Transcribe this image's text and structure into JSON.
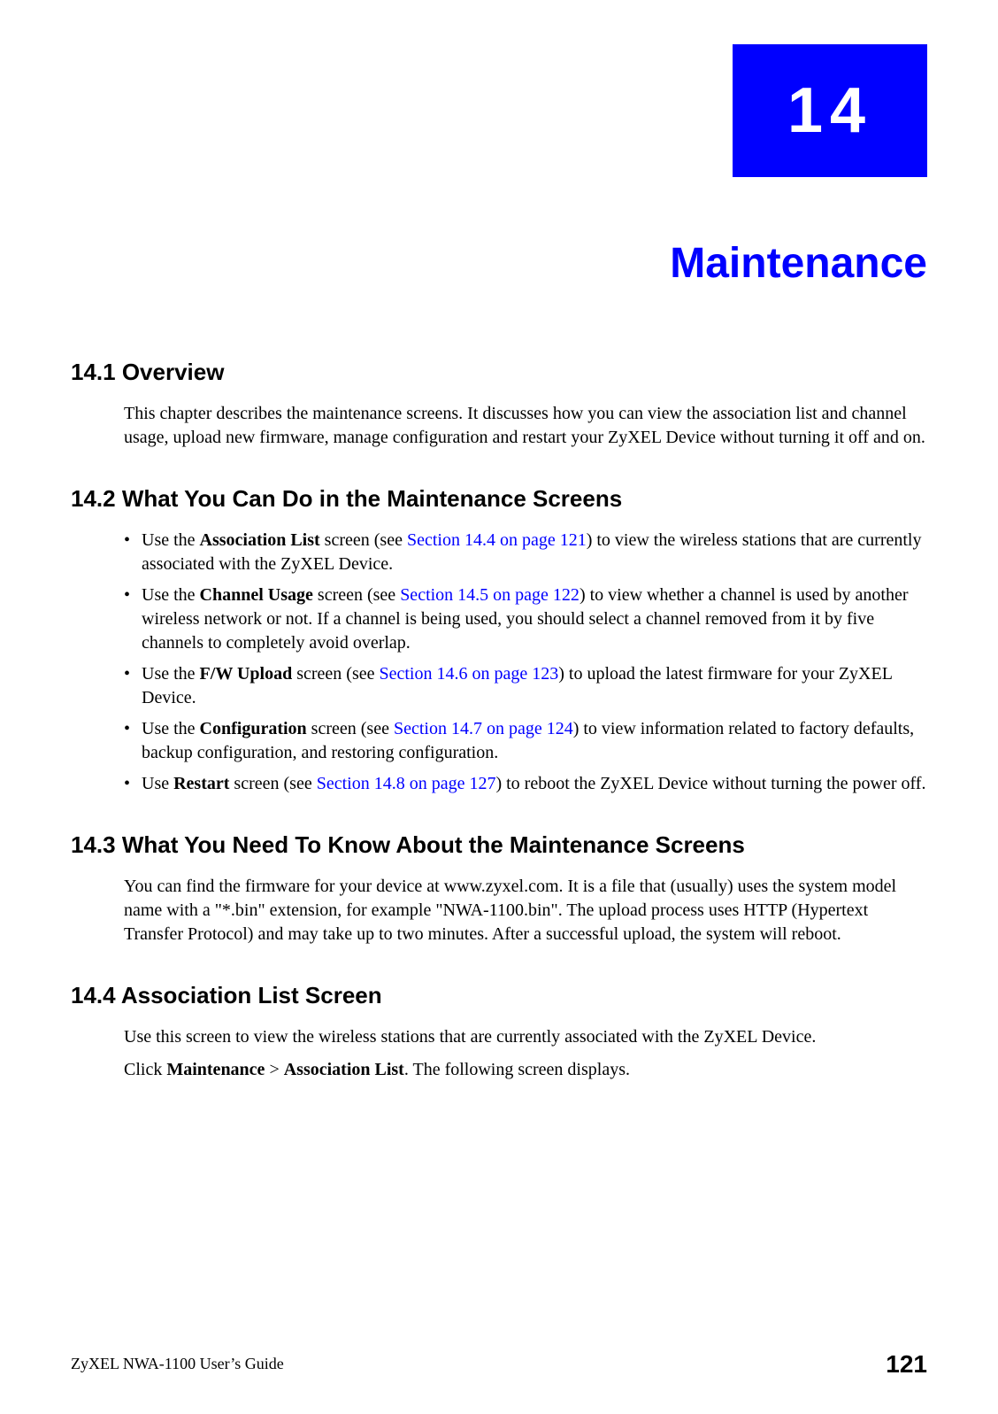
{
  "chapter": {
    "number": "14",
    "title": "Maintenance"
  },
  "sections": {
    "s1": {
      "heading": "14.1  Overview",
      "body": "This chapter describes the maintenance screens. It discusses how you can view the association list and channel usage, upload new firmware, manage configuration and restart your ZyXEL Device without turning it off and on."
    },
    "s2": {
      "heading": "14.2  What You Can Do in the Maintenance Screens",
      "items": {
        "i1": {
          "pre": "Use the ",
          "bold": "Association List",
          "mid": " screen (see ",
          "link": "Section 14.4 on page 121",
          "post": ") to view the wireless stations that are currently associated with the ZyXEL Device."
        },
        "i2": {
          "pre": "Use the ",
          "bold": "Channel Usage",
          "mid": " screen (see ",
          "link": "Section 14.5 on page 122",
          "post": ") to view whether a channel is used by another wireless network or not. If a channel is being used, you should select a channel removed from it by five channels to completely avoid overlap."
        },
        "i3": {
          "pre": "Use the ",
          "bold": "F/W Upload",
          "mid": " screen (see ",
          "link": "Section 14.6 on page 123",
          "post": ") to upload the latest firmware for your ZyXEL Device."
        },
        "i4": {
          "pre": "Use the ",
          "bold": "Configuration",
          "mid": " screen (see ",
          "link": "Section 14.7 on page 124",
          "post": ") to view information related to factory defaults, backup configuration, and restoring configuration."
        },
        "i5": {
          "pre": "Use ",
          "bold": "Restart",
          "mid": " screen (see ",
          "link": "Section 14.8 on page 127",
          "post": ") to reboot the ZyXEL Device without turning the power off."
        }
      }
    },
    "s3": {
      "heading": "14.3  What You Need To Know About the Maintenance Screens",
      "body": "You can find the firmware for your device at www.zyxel.com. It is a file that (usually) uses the system model name with a \"*.bin\" extension, for example \"NWA-1100.bin\". The upload process uses HTTP (Hypertext Transfer Protocol) and may take up to two minutes. After a successful upload, the system will reboot."
    },
    "s4": {
      "heading": "14.4  Association List Screen",
      "body1": "Use this screen to view the wireless stations that are currently associated with the ZyXEL Device.",
      "body2_pre": "Click ",
      "body2_b1": "Maintenance",
      "body2_mid": " > ",
      "body2_b2": "Association List",
      "body2_post": ". The following screen displays."
    }
  },
  "footer": {
    "left": "ZyXEL NWA-1100 User’s Guide",
    "right": "121"
  }
}
